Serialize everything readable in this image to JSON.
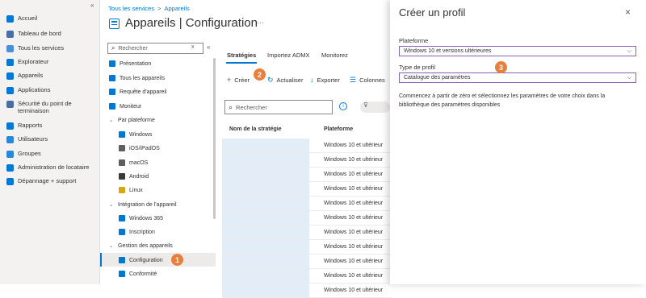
{
  "nav": {
    "collapse": "«",
    "items": [
      {
        "label": "Accueil",
        "icon": "home-icon",
        "color": "#0078d4"
      },
      {
        "label": "Tableau de bord",
        "icon": "dashboard-icon",
        "color": "#4a6fa5"
      },
      {
        "label": "Tous les services",
        "icon": "all-services-icon",
        "color": "#4a90d9"
      },
      {
        "label": "Explorateur",
        "icon": "explorer-icon",
        "color": "#0078d4"
      },
      {
        "label": "Appareils",
        "icon": "devices-icon",
        "color": "#0078d4"
      },
      {
        "label": "Applications",
        "icon": "applications-icon",
        "color": "#0078d4"
      },
      {
        "label": "Sécurité du point de terminaison",
        "icon": "endpoint-security-icon",
        "color": "#4a6fa5"
      },
      {
        "label": "Rapports",
        "icon": "reports-icon",
        "color": "#0078d4"
      },
      {
        "label": "Utilisateurs",
        "icon": "users-icon",
        "color": "#2b88d8"
      },
      {
        "label": "Groupes",
        "icon": "groups-icon",
        "color": "#2b88d8"
      },
      {
        "label": "Administration de locataire",
        "icon": "tenant-admin-icon",
        "color": "#0078d4"
      },
      {
        "label": "Dépannage + support",
        "icon": "troubleshooting-icon",
        "color": "#0078d4"
      }
    ]
  },
  "header": {
    "breadcrumb": [
      "Tous les services",
      ">",
      "Appareils"
    ],
    "title": "Appareils | Configuration",
    "more": "···"
  },
  "blade": {
    "search_placeholder": "Rechercher",
    "search_clear": "x",
    "collapse": "«",
    "items": [
      {
        "label": "Présentation",
        "type": "item",
        "icon": "info-icon",
        "color": "#0078d4"
      },
      {
        "label": "Tous les appareils",
        "type": "item",
        "icon": "all-devices-icon",
        "color": "#0078d4"
      },
      {
        "label": "Requête d'appareil",
        "type": "item",
        "icon": "device-query-icon",
        "color": "#0078d4"
      },
      {
        "label": "Moniteur",
        "type": "item",
        "icon": "monitor-icon",
        "color": "#0078d4"
      },
      {
        "label": "Par plateforme",
        "type": "group",
        "icon": "chevron-down-icon"
      },
      {
        "label": "Windows",
        "type": "sub",
        "icon": "windows-icon",
        "color": "#0078d4"
      },
      {
        "label": "iOS/iPadOS",
        "type": "sub",
        "icon": "ios-icon",
        "color": "#605e5c"
      },
      {
        "label": "macOS",
        "type": "sub",
        "icon": "macos-icon",
        "color": "#605e5c"
      },
      {
        "label": "Android",
        "type": "sub",
        "icon": "android-icon",
        "color": "#3a3a3a"
      },
      {
        "label": "Linux",
        "type": "sub",
        "icon": "linux-icon",
        "color": "#d9a70b"
      },
      {
        "label": "Intégration de l'appareil",
        "type": "group",
        "icon": "chevron-down-icon"
      },
      {
        "label": "Windows 365",
        "type": "sub",
        "icon": "windows-365-icon",
        "color": "#0078d4"
      },
      {
        "label": "Inscription",
        "type": "sub",
        "icon": "enrollment-icon",
        "color": "#0078d4"
      },
      {
        "label": "Gestion des appareils",
        "type": "group",
        "icon": "chevron-down-icon"
      },
      {
        "label": "Configuration",
        "type": "sub",
        "icon": "configuration-icon",
        "color": "#0078d4",
        "selected": true
      },
      {
        "label": "Conformité",
        "type": "sub",
        "icon": "compliance-icon",
        "color": "#0078d4"
      }
    ]
  },
  "tabs": [
    "Stratégies",
    "Importez ADMX",
    "Monitorez"
  ],
  "toolbar": {
    "create": "Créer",
    "refresh": "Actualiser",
    "export": "Exporter",
    "columns": "Colonnes"
  },
  "list": {
    "search_placeholder": "Rechercher",
    "col_name": "Nom de la stratégie",
    "col_platform": "Plateforme",
    "rows": [
      "Windows 10 et ultérieur",
      "Windows 10 et ultérieur",
      "Windows 10 et ultérieur",
      "Windows 10 et ultérieur",
      "Windows 10 et ultérieur",
      "Windows 10 et ultérieur",
      "Windows 10 et ultérieur",
      "Windows 10 et ultérieur",
      "Windows 10 et ultérieur",
      "Windows 10 et ultérieur",
      "Windows 10 et ultérieur"
    ]
  },
  "panel": {
    "title": "Créer un profil",
    "close": "×",
    "platform_label": "Plateforme",
    "platform_value": "Windows 10 et versions ultérieures",
    "profile_type_label": "Type de profil",
    "profile_type_value": "Catalogue des paramètres",
    "description": "Commencez à partir de zéro et sélectionnez les paramètres de votre choix dans la bibliothèque des paramètres disponibles"
  },
  "badges": [
    "1",
    "2",
    "3"
  ],
  "colors": {
    "accent": "#0078d4",
    "badge": "#e97f3d",
    "select_border": "#8764b8"
  }
}
